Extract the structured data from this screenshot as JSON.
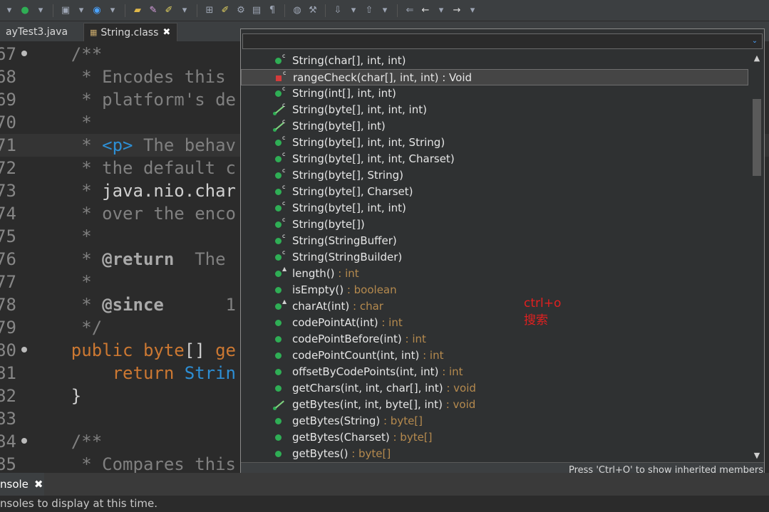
{
  "tabs": [
    {
      "label": "ayTest3.java"
    },
    {
      "label": "String.class",
      "close": "✖"
    }
  ],
  "editor_lines": [
    {
      "num": "67",
      "fold": true,
      "parts": [
        {
          "c": "cm",
          "t": "    /**"
        }
      ]
    },
    {
      "num": "68",
      "parts": [
        {
          "c": "cm",
          "t": "     * Encodes this "
        }
      ]
    },
    {
      "num": "69",
      "parts": [
        {
          "c": "cm",
          "t": "     * platform's de"
        }
      ]
    },
    {
      "num": "70",
      "parts": [
        {
          "c": "cm",
          "t": "     *"
        }
      ]
    },
    {
      "num": "71",
      "hl": true,
      "parts": [
        {
          "c": "cm",
          "t": "     * "
        },
        {
          "c": "tg",
          "t": "<p>"
        },
        {
          "c": "cm",
          "t": " The behav"
        }
      ]
    },
    {
      "num": "72",
      "parts": [
        {
          "c": "cm",
          "t": "     * the default c"
        }
      ]
    },
    {
      "num": "73",
      "parts": [
        {
          "c": "cm",
          "t": "     * "
        },
        {
          "c": "pl",
          "t": "java.nio.char"
        }
      ]
    },
    {
      "num": "74",
      "parts": [
        {
          "c": "cm",
          "t": "     * over the enco"
        }
      ]
    },
    {
      "num": "75",
      "parts": [
        {
          "c": "cm",
          "t": "     *"
        }
      ]
    },
    {
      "num": "76",
      "parts": [
        {
          "c": "cm",
          "t": "     * "
        },
        {
          "c": "jd",
          "t": "@return"
        },
        {
          "c": "cm",
          "t": "  The "
        }
      ]
    },
    {
      "num": "77",
      "parts": [
        {
          "c": "cm",
          "t": "     *"
        }
      ]
    },
    {
      "num": "78",
      "parts": [
        {
          "c": "cm",
          "t": "     * "
        },
        {
          "c": "jd",
          "t": "@since"
        },
        {
          "c": "cm",
          "t": "      1"
        }
      ]
    },
    {
      "num": "79",
      "parts": [
        {
          "c": "cm",
          "t": "     */"
        }
      ]
    },
    {
      "num": "80",
      "fold": true,
      "parts": [
        {
          "c": "kw",
          "t": "    public byte"
        },
        {
          "c": "pl",
          "t": "[] "
        },
        {
          "c": "kw",
          "t": "ge"
        }
      ]
    },
    {
      "num": "81",
      "parts": [
        {
          "c": "kw",
          "t": "        return "
        },
        {
          "c": "fn",
          "t": "Strin"
        }
      ]
    },
    {
      "num": "82",
      "parts": [
        {
          "c": "pl",
          "t": "    }"
        }
      ]
    },
    {
      "num": "83",
      "parts": [
        {
          "c": "pl",
          "t": ""
        }
      ]
    },
    {
      "num": "84",
      "fold": true,
      "parts": [
        {
          "c": "cm",
          "t": "    /**"
        }
      ]
    },
    {
      "num": "85",
      "parts": [
        {
          "c": "cm",
          "t": "     * Compares this"
        }
      ]
    }
  ],
  "outline_popup": {
    "filter_value": "",
    "filter_menu_icon": "⌄",
    "items": [
      {
        "icon": "public",
        "dec": "c",
        "label": "String(char[], int, int)",
        "ret": ""
      },
      {
        "icon": "private",
        "dec": "c",
        "label": "rangeCheck(char[], int, int) : Void",
        "ret": "",
        "selected": true
      },
      {
        "icon": "public",
        "dec": "c",
        "label": "String(int[], int, int)",
        "ret": ""
      },
      {
        "icon": "deprecated",
        "dec": "c",
        "label": "String(byte[], int, int, int)",
        "ret": ""
      },
      {
        "icon": "deprecated",
        "dec": "c",
        "label": "String(byte[], int)",
        "ret": ""
      },
      {
        "icon": "public",
        "dec": "c",
        "label": "String(byte[], int, int, String)",
        "ret": ""
      },
      {
        "icon": "public",
        "dec": "c",
        "label": "String(byte[], int, int, Charset)",
        "ret": ""
      },
      {
        "icon": "public",
        "dec": "c",
        "label": "String(byte[], String)",
        "ret": ""
      },
      {
        "icon": "public",
        "dec": "c",
        "label": "String(byte[], Charset)",
        "ret": ""
      },
      {
        "icon": "public",
        "dec": "c",
        "label": "String(byte[], int, int)",
        "ret": ""
      },
      {
        "icon": "public",
        "dec": "c",
        "label": "String(byte[])",
        "ret": ""
      },
      {
        "icon": "public",
        "dec": "c",
        "label": "String(StringBuffer)",
        "ret": ""
      },
      {
        "icon": "public",
        "dec": "c",
        "label": "String(StringBuilder)",
        "ret": ""
      },
      {
        "icon": "public",
        "dec": "▲",
        "label": "length()",
        "ret": " : int"
      },
      {
        "icon": "public",
        "dec": "",
        "label": "isEmpty()",
        "ret": " : boolean"
      },
      {
        "icon": "public",
        "dec": "▲",
        "label": "charAt(int)",
        "ret": " : char"
      },
      {
        "icon": "public",
        "dec": "",
        "label": "codePointAt(int)",
        "ret": " : int"
      },
      {
        "icon": "public",
        "dec": "",
        "label": "codePointBefore(int)",
        "ret": " : int"
      },
      {
        "icon": "public",
        "dec": "",
        "label": "codePointCount(int, int)",
        "ret": " : int"
      },
      {
        "icon": "public",
        "dec": "",
        "label": "offsetByCodePoints(int, int)",
        "ret": " : int"
      },
      {
        "icon": "public",
        "dec": "",
        "label": "getChars(int, int, char[], int)",
        "ret": " : void"
      },
      {
        "icon": "deprecated",
        "dec": "",
        "label": "getBytes(int, int, byte[], int)",
        "ret": " : void"
      },
      {
        "icon": "public",
        "dec": "",
        "label": "getBytes(String)",
        "ret": " : byte[]"
      },
      {
        "icon": "public",
        "dec": "",
        "label": "getBytes(Charset)",
        "ret": " : byte[]"
      },
      {
        "icon": "public",
        "dec": "",
        "label": "getBytes()",
        "ret": " : byte[]"
      }
    ],
    "status": "Press 'Ctrl+O' to show inherited members"
  },
  "annotation": {
    "line1": "ctrl+o",
    "line2": "搜索"
  },
  "console": {
    "tab_label": "nsole",
    "close": "✖",
    "message": "nsoles to display at this time."
  }
}
